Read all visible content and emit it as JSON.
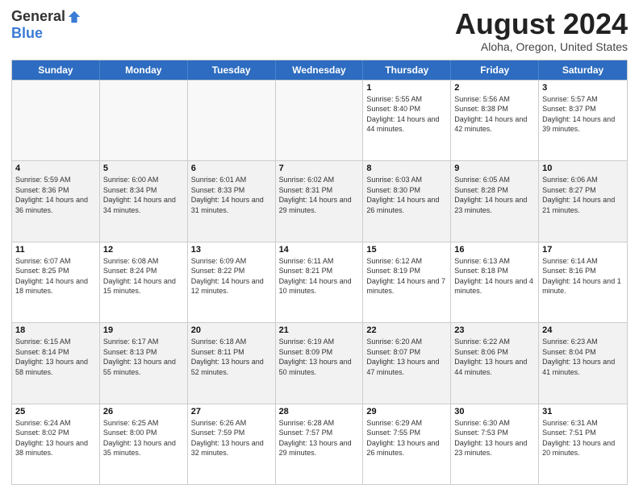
{
  "header": {
    "logo": {
      "general": "General",
      "blue": "Blue"
    },
    "title": "August 2024",
    "location": "Aloha, Oregon, United States"
  },
  "calendar": {
    "weekdays": [
      "Sunday",
      "Monday",
      "Tuesday",
      "Wednesday",
      "Thursday",
      "Friday",
      "Saturday"
    ],
    "rows": [
      {
        "cells": [
          {
            "day": "",
            "info": "",
            "empty": true
          },
          {
            "day": "",
            "info": "",
            "empty": true
          },
          {
            "day": "",
            "info": "",
            "empty": true
          },
          {
            "day": "",
            "info": "",
            "empty": true
          },
          {
            "day": "1",
            "info": "Sunrise: 5:55 AM\nSunset: 8:40 PM\nDaylight: 14 hours and 44 minutes.",
            "empty": false
          },
          {
            "day": "2",
            "info": "Sunrise: 5:56 AM\nSunset: 8:38 PM\nDaylight: 14 hours and 42 minutes.",
            "empty": false
          },
          {
            "day": "3",
            "info": "Sunrise: 5:57 AM\nSunset: 8:37 PM\nDaylight: 14 hours and 39 minutes.",
            "empty": false
          }
        ],
        "alt": false
      },
      {
        "cells": [
          {
            "day": "4",
            "info": "Sunrise: 5:59 AM\nSunset: 8:36 PM\nDaylight: 14 hours and 36 minutes.",
            "empty": false
          },
          {
            "day": "5",
            "info": "Sunrise: 6:00 AM\nSunset: 8:34 PM\nDaylight: 14 hours and 34 minutes.",
            "empty": false
          },
          {
            "day": "6",
            "info": "Sunrise: 6:01 AM\nSunset: 8:33 PM\nDaylight: 14 hours and 31 minutes.",
            "empty": false
          },
          {
            "day": "7",
            "info": "Sunrise: 6:02 AM\nSunset: 8:31 PM\nDaylight: 14 hours and 29 minutes.",
            "empty": false
          },
          {
            "day": "8",
            "info": "Sunrise: 6:03 AM\nSunset: 8:30 PM\nDaylight: 14 hours and 26 minutes.",
            "empty": false
          },
          {
            "day": "9",
            "info": "Sunrise: 6:05 AM\nSunset: 8:28 PM\nDaylight: 14 hours and 23 minutes.",
            "empty": false
          },
          {
            "day": "10",
            "info": "Sunrise: 6:06 AM\nSunset: 8:27 PM\nDaylight: 14 hours and 21 minutes.",
            "empty": false
          }
        ],
        "alt": true
      },
      {
        "cells": [
          {
            "day": "11",
            "info": "Sunrise: 6:07 AM\nSunset: 8:25 PM\nDaylight: 14 hours and 18 minutes.",
            "empty": false
          },
          {
            "day": "12",
            "info": "Sunrise: 6:08 AM\nSunset: 8:24 PM\nDaylight: 14 hours and 15 minutes.",
            "empty": false
          },
          {
            "day": "13",
            "info": "Sunrise: 6:09 AM\nSunset: 8:22 PM\nDaylight: 14 hours and 12 minutes.",
            "empty": false
          },
          {
            "day": "14",
            "info": "Sunrise: 6:11 AM\nSunset: 8:21 PM\nDaylight: 14 hours and 10 minutes.",
            "empty": false
          },
          {
            "day": "15",
            "info": "Sunrise: 6:12 AM\nSunset: 8:19 PM\nDaylight: 14 hours and 7 minutes.",
            "empty": false
          },
          {
            "day": "16",
            "info": "Sunrise: 6:13 AM\nSunset: 8:18 PM\nDaylight: 14 hours and 4 minutes.",
            "empty": false
          },
          {
            "day": "17",
            "info": "Sunrise: 6:14 AM\nSunset: 8:16 PM\nDaylight: 14 hours and 1 minute.",
            "empty": false
          }
        ],
        "alt": false
      },
      {
        "cells": [
          {
            "day": "18",
            "info": "Sunrise: 6:15 AM\nSunset: 8:14 PM\nDaylight: 13 hours and 58 minutes.",
            "empty": false
          },
          {
            "day": "19",
            "info": "Sunrise: 6:17 AM\nSunset: 8:13 PM\nDaylight: 13 hours and 55 minutes.",
            "empty": false
          },
          {
            "day": "20",
            "info": "Sunrise: 6:18 AM\nSunset: 8:11 PM\nDaylight: 13 hours and 52 minutes.",
            "empty": false
          },
          {
            "day": "21",
            "info": "Sunrise: 6:19 AM\nSunset: 8:09 PM\nDaylight: 13 hours and 50 minutes.",
            "empty": false
          },
          {
            "day": "22",
            "info": "Sunrise: 6:20 AM\nSunset: 8:07 PM\nDaylight: 13 hours and 47 minutes.",
            "empty": false
          },
          {
            "day": "23",
            "info": "Sunrise: 6:22 AM\nSunset: 8:06 PM\nDaylight: 13 hours and 44 minutes.",
            "empty": false
          },
          {
            "day": "24",
            "info": "Sunrise: 6:23 AM\nSunset: 8:04 PM\nDaylight: 13 hours and 41 minutes.",
            "empty": false
          }
        ],
        "alt": true
      },
      {
        "cells": [
          {
            "day": "25",
            "info": "Sunrise: 6:24 AM\nSunset: 8:02 PM\nDaylight: 13 hours and 38 minutes.",
            "empty": false
          },
          {
            "day": "26",
            "info": "Sunrise: 6:25 AM\nSunset: 8:00 PM\nDaylight: 13 hours and 35 minutes.",
            "empty": false
          },
          {
            "day": "27",
            "info": "Sunrise: 6:26 AM\nSunset: 7:59 PM\nDaylight: 13 hours and 32 minutes.",
            "empty": false
          },
          {
            "day": "28",
            "info": "Sunrise: 6:28 AM\nSunset: 7:57 PM\nDaylight: 13 hours and 29 minutes.",
            "empty": false
          },
          {
            "day": "29",
            "info": "Sunrise: 6:29 AM\nSunset: 7:55 PM\nDaylight: 13 hours and 26 minutes.",
            "empty": false
          },
          {
            "day": "30",
            "info": "Sunrise: 6:30 AM\nSunset: 7:53 PM\nDaylight: 13 hours and 23 minutes.",
            "empty": false
          },
          {
            "day": "31",
            "info": "Sunrise: 6:31 AM\nSunset: 7:51 PM\nDaylight: 13 hours and 20 minutes.",
            "empty": false
          }
        ],
        "alt": false
      }
    ]
  }
}
